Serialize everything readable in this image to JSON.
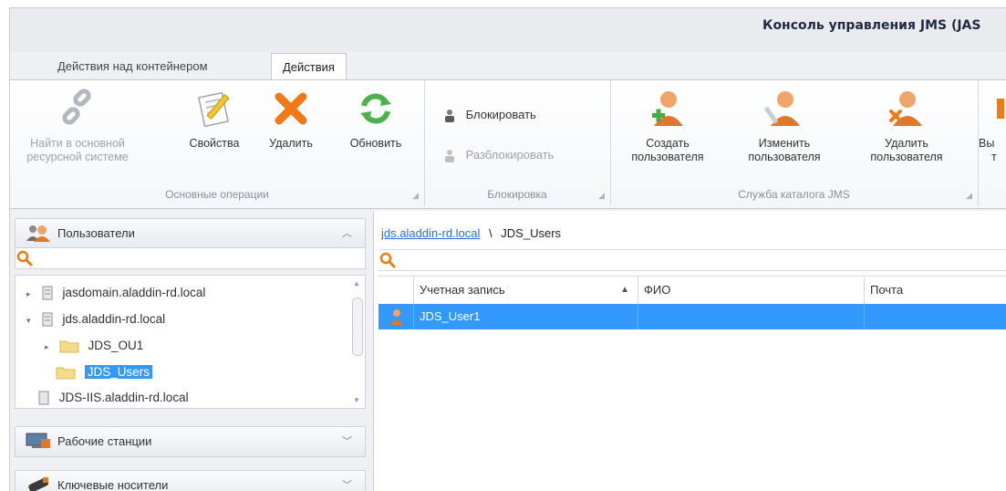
{
  "window": {
    "title": "Консоль управления JMS (JAS"
  },
  "tabs": [
    {
      "label": "Действия над контейнером",
      "active": false
    },
    {
      "label": "Действия",
      "active": true
    }
  ],
  "ribbon": {
    "groups": {
      "basic": {
        "label": "Основные операции"
      },
      "lock": {
        "label": "Блокировка"
      },
      "catalog": {
        "label": "Служба каталога JMS"
      }
    },
    "buttons": {
      "find_line1": "Найти в основной",
      "find_line2": "ресурсной системе",
      "properties": "Свойства",
      "delete": "Удалить",
      "refresh": "Обновить",
      "block": "Блокировать",
      "unblock": "Разблокировать",
      "create_line1": "Создать",
      "create_line2": "пользователя",
      "edit_line1": "Изменить",
      "edit_line2": "пользователя",
      "deluser_line1": "Удалить",
      "deluser_line2": "пользователя",
      "cut_line1": "Вы",
      "cut_line2": "т"
    }
  },
  "sidebar": {
    "users_header": "Пользователи",
    "workstations_header": "Рабочие станции",
    "keys_header": "Ключевые носители",
    "tree": [
      {
        "label": "jasdomain.aladdin-rd.local",
        "expanded": false
      },
      {
        "label": "jds.aladdin-rd.local",
        "expanded": true
      },
      {
        "label": "JDS_OU1",
        "expanded": false
      },
      {
        "label": "JDS_Users",
        "selected": true
      },
      {
        "label": "JDS-IIS.aladdin-rd.local"
      }
    ]
  },
  "main": {
    "breadcrumb": {
      "domain": "jds.aladdin-rd.local",
      "separator": "\\",
      "current": "JDS_Users"
    },
    "table": {
      "columns": [
        "Учетная запись",
        "ФИО",
        "Почта"
      ],
      "sort_indicator": "▲",
      "rows": [
        {
          "account": "JDS_User1",
          "fio": "",
          "mail": ""
        }
      ]
    }
  },
  "colors": {
    "selection": "#3399ff",
    "accent_orange": "#f07a1a",
    "link": "#2a6fd6"
  }
}
